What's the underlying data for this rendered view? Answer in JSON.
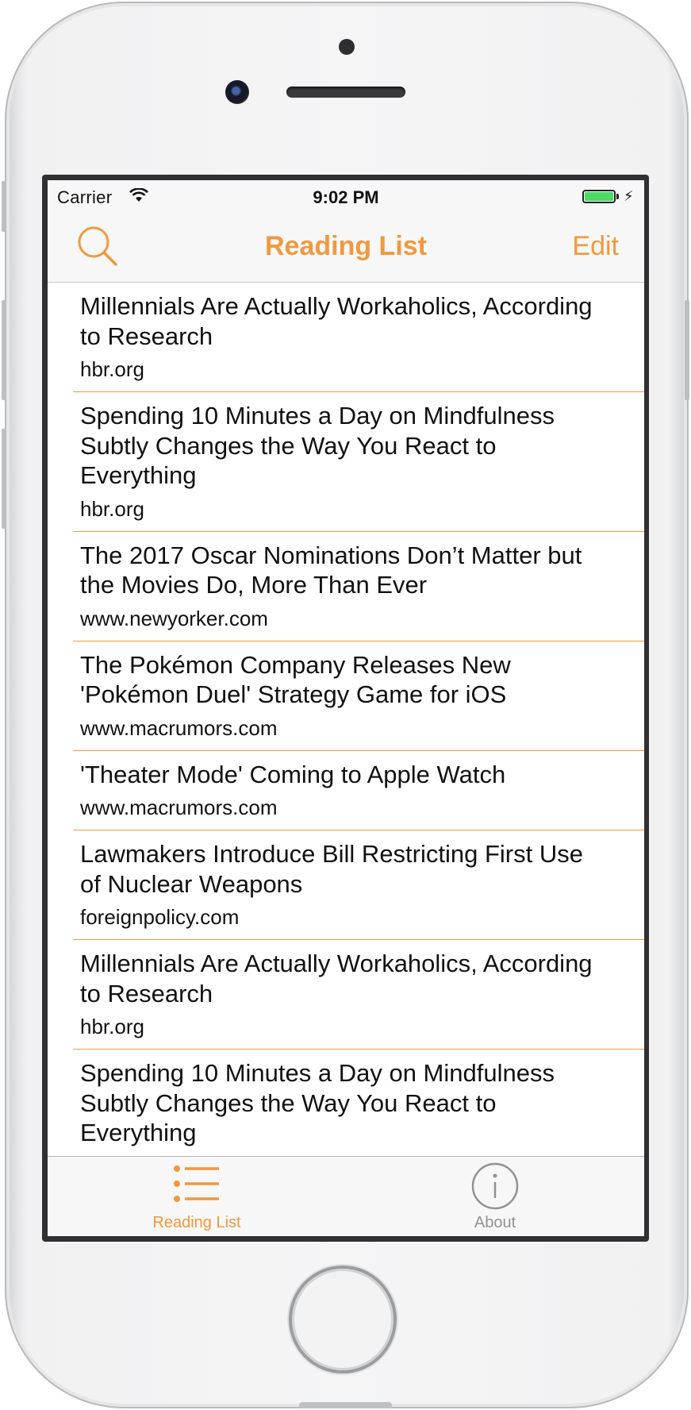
{
  "status_bar": {
    "carrier": "Carrier",
    "time": "9:02 PM",
    "battery_level": 1.0
  },
  "nav": {
    "title": "Reading List",
    "edit_label": "Edit",
    "search_icon": "search-icon"
  },
  "articles": [
    {
      "title": "Millennials Are Actually Workaholics, According to Research",
      "domain": "hbr.org"
    },
    {
      "title": "Spending 10 Minutes a Day on Mindfulness Subtly Changes the Way You React to Everything",
      "domain": "hbr.org"
    },
    {
      "title": "The 2017 Oscar Nominations Don’t Matter but the Movies Do, More Than Ever",
      "domain": "www.newyorker.com"
    },
    {
      "title": "The Pokémon Company Releases New 'Pokémon Duel' Strategy Game for iOS",
      "domain": "www.macrumors.com"
    },
    {
      "title": "'Theater Mode' Coming to Apple Watch",
      "domain": "www.macrumors.com"
    },
    {
      "title": "Lawmakers Introduce Bill Restricting First Use of Nuclear Weapons",
      "domain": "foreignpolicy.com"
    },
    {
      "title": "Millennials Are Actually Workaholics, According to Research",
      "domain": "hbr.org"
    },
    {
      "title": "Spending 10 Minutes a Day on Mindfulness Subtly Changes the Way You React to Everything",
      "domain": ""
    }
  ],
  "tabs": [
    {
      "label": "Reading List",
      "icon": "list-icon",
      "active": true
    },
    {
      "label": "About",
      "icon": "info-icon",
      "active": false
    }
  ],
  "colors": {
    "accent": "#f0993f",
    "inactive": "#929292",
    "battery": "#4cd964"
  }
}
